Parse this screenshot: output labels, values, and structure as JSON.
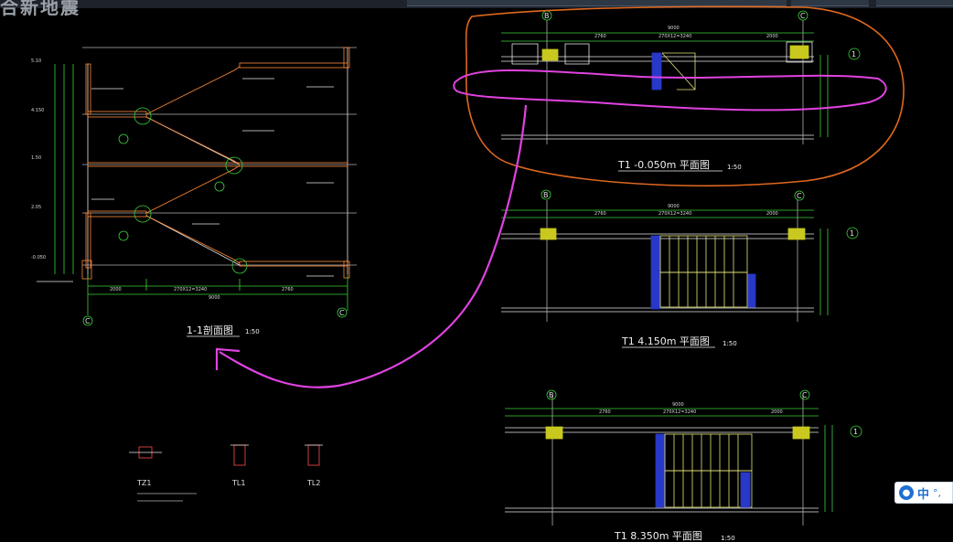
{
  "window": {
    "top_fragment": "合新地震"
  },
  "section": {
    "title": "1-1剖面图",
    "scale": "1:50",
    "axes": [
      "C",
      "C"
    ],
    "dims": {
      "left": "2000",
      "mid": "270X12=3240",
      "right": "2760",
      "total": "9000"
    },
    "levels": [
      "5.10",
      "4.150",
      "1.50",
      "2.05",
      "-0.050"
    ]
  },
  "plans": [
    {
      "title": "T1 -0.050m 平面图",
      "scale": "1:50",
      "axes": [
        "B",
        "C",
        "1"
      ],
      "dims": [
        "2760",
        "270X12=3240",
        "2000"
      ],
      "total": "9000"
    },
    {
      "title": "T1 4.150m 平面图",
      "scale": "1:50",
      "axes": [
        "B",
        "C",
        "1"
      ],
      "dims": [
        "2760",
        "270X12=3240",
        "2000"
      ],
      "total": "9000"
    },
    {
      "title": "T1 8.350m 平面图",
      "scale": "1:50",
      "axes": [
        "B",
        "C",
        "1"
      ],
      "dims": [
        "2760",
        "270X12=3240",
        "2000"
      ],
      "total": "9000"
    }
  ],
  "details": [
    {
      "label": "TZ1"
    },
    {
      "label": "TL1"
    },
    {
      "label": "TL2"
    }
  ],
  "colors": {
    "background": "#000000",
    "lines": "#e6e6e6",
    "dimension": "#3ad23a",
    "stair": "#e6e67a",
    "column": "#ff8a3a",
    "annotation_pink": "#e043e0",
    "annotation_orange": "#e0681e",
    "yellow_block": "#c8c81e",
    "blue_block": "#2838c8"
  },
  "ime": {
    "icon": "user-icon",
    "label": "中",
    "dots": "°,"
  }
}
